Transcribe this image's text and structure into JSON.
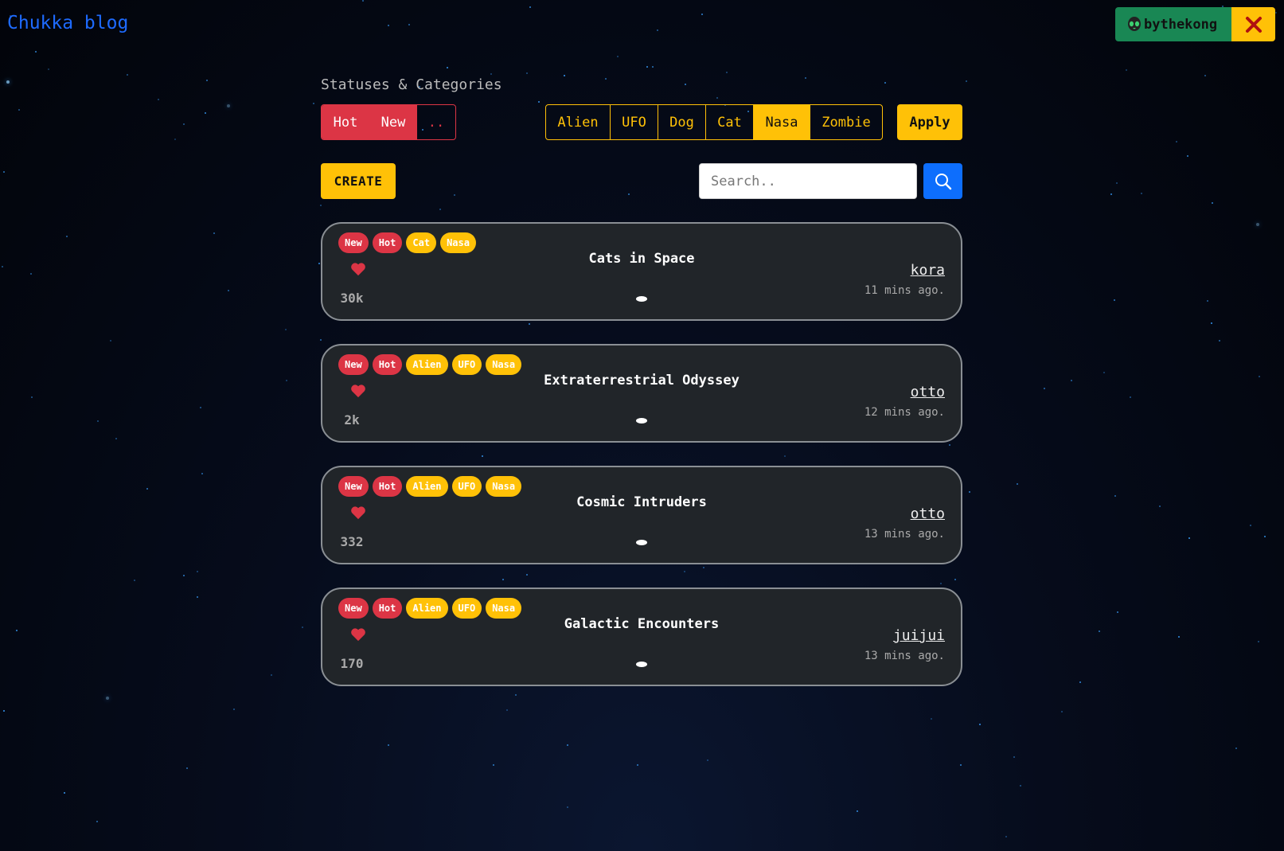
{
  "brand": "Chukka blog",
  "user": {
    "name": "bythekong",
    "icon": "alien-icon",
    "logout_icon": "close-x-icon"
  },
  "filters": {
    "label": "Statuses & Categories",
    "statuses": [
      {
        "label": "Hot",
        "active": true
      },
      {
        "label": "New",
        "active": true
      },
      {
        "label": "..",
        "active": false
      }
    ],
    "categories": [
      {
        "label": "Alien",
        "active": false
      },
      {
        "label": "UFO",
        "active": false
      },
      {
        "label": "Dog",
        "active": false
      },
      {
        "label": "Cat",
        "active": false
      },
      {
        "label": "Nasa",
        "active": true
      },
      {
        "label": "Zombie",
        "active": false
      }
    ],
    "apply_label": "Apply"
  },
  "toolbar": {
    "create_label": "CREATE",
    "search_placeholder": "Search..",
    "search_value": ""
  },
  "posts": [
    {
      "badges": [
        "New",
        "Hot"
      ],
      "categories": [
        "Cat",
        "Nasa"
      ],
      "title": "Cats in Space",
      "likes": "30k",
      "author": "kora",
      "time": "11 mins ago."
    },
    {
      "badges": [
        "New",
        "Hot"
      ],
      "categories": [
        "Alien",
        "UFO",
        "Nasa"
      ],
      "title": "Extraterrestrial Odyssey",
      "likes": "2k",
      "author": "otto",
      "time": "12 mins ago."
    },
    {
      "badges": [
        "New",
        "Hot"
      ],
      "categories": [
        "Alien",
        "UFO",
        "Nasa"
      ],
      "title": "Cosmic Intruders",
      "likes": "332",
      "author": "otto",
      "time": "13 mins ago."
    },
    {
      "badges": [
        "New",
        "Hot"
      ],
      "categories": [
        "Alien",
        "UFO",
        "Nasa"
      ],
      "title": "Galactic Encounters",
      "likes": "170",
      "author": "juijui",
      "time": "13 mins ago."
    }
  ],
  "colors": {
    "brand": "#1e6bff",
    "status": "#dc3545",
    "category": "#ffc107",
    "user": "#198754",
    "search": "#0d6efd",
    "card": "#212529"
  }
}
